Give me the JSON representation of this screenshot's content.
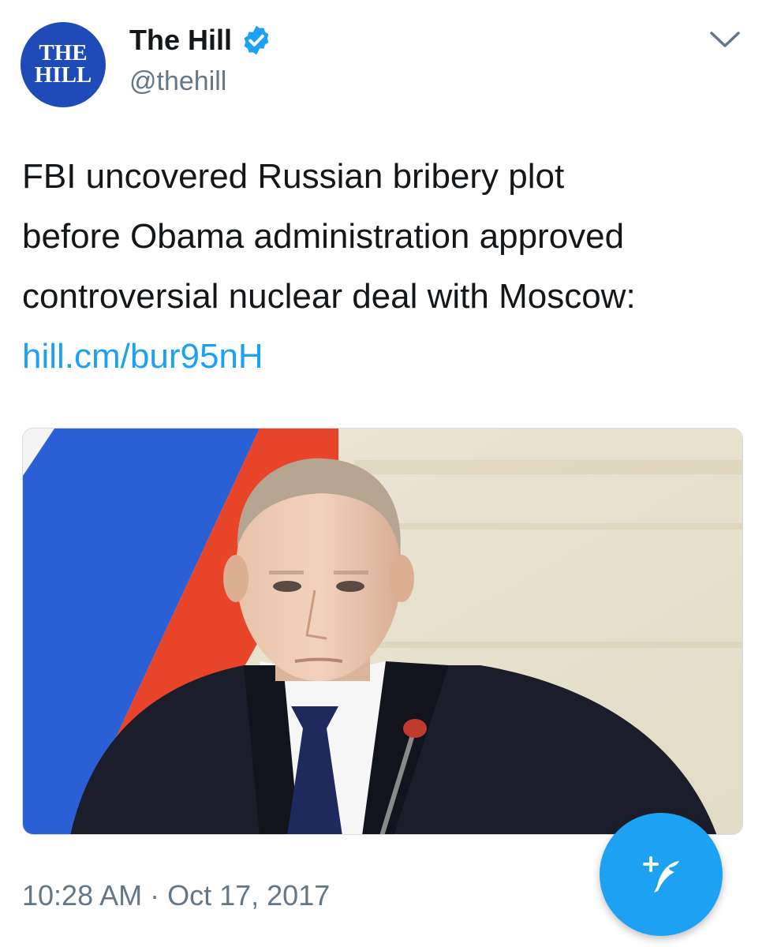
{
  "author": {
    "display_name": "The Hill",
    "handle": "@thehill",
    "avatar_text_line1": "THE",
    "avatar_text_line2": "HILL",
    "verified": true
  },
  "tweet": {
    "text_lines": [
      "FBI uncovered Russian bribery plot",
      "before Obama administration approved",
      "controversial nuclear deal with Moscow:"
    ],
    "link_text": "hill.cm/bur95nH",
    "timestamp": "10:28 AM · Oct 17, 2017"
  },
  "icons": {
    "verified": "verified-badge-icon",
    "menu": "chevron-down-icon",
    "compose": "compose-tweet-icon"
  },
  "colors": {
    "brand_blue": "#1da1f2",
    "text": "#14171a",
    "secondary_text": "#657786",
    "avatar_bg": "#1f4bb8"
  }
}
